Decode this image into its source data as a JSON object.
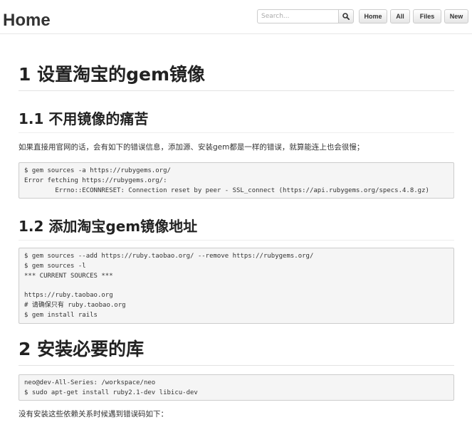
{
  "header": {
    "title": "Home",
    "search_placeholder": "Search...",
    "buttons": {
      "home": "Home",
      "all": "All",
      "files": "Files",
      "new": "New"
    }
  },
  "article": {
    "h1_setup_mirror": "1 设置淘宝的gem镜像",
    "h2_pain": "1.1 不用镜像的痛苦",
    "p_pain": "如果直接用官网的话，会有如下的错误信息，添加源、安装gem都是一样的错误，就算能连上也会很慢；",
    "code_error": [
      "$ gem sources -a https://rubygems.org/",
      "Error fetching https://rubygems.org/:",
      "        Errno::ECONNRESET: Connection reset by peer - SSL_connect (https://api.rubygems.org/specs.4.8.gz)"
    ],
    "h2_add_mirror": "1.2 添加淘宝gem镜像地址",
    "code_add": [
      "$ gem sources --add https://ruby.taobao.org/ --remove https://rubygems.org/",
      "$ gem sources -l",
      "*** CURRENT SOURCES ***",
      "",
      "https://ruby.taobao.org",
      "# 请确保只有 ruby.taobao.org",
      "$ gem install rails"
    ],
    "h1_install_libs": "2 安装必要的库",
    "code_install": [
      "neo@dev-All-Series: /workspace/neo",
      "$ sudo apt-get install ruby2.1-dev libicu-dev"
    ],
    "p_error": "没有安装这些依赖关系时候遇到错误码如下："
  },
  "icons": {
    "search": "search-icon"
  }
}
